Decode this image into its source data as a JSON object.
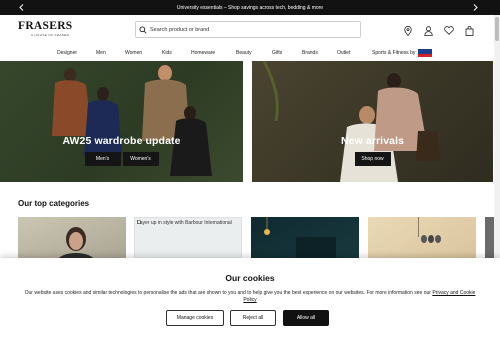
{
  "promo": {
    "text": "University essentials – Shop savings across tech, bedding & more",
    "prev_icon": "chevron-left-icon",
    "next_icon": "chevron-right-icon"
  },
  "header": {
    "logo": {
      "name": "FRASERS",
      "tagline": "A HOUSE OF FRASER"
    },
    "search": {
      "placeholder": "Search product or brand"
    },
    "icons": [
      "location-pin-icon",
      "account-icon",
      "heart-icon",
      "bag-icon"
    ]
  },
  "nav": {
    "items": [
      "Designer",
      "Men",
      "Women",
      "Kids",
      "Homeware",
      "Beauty",
      "Gifts",
      "Brands",
      "Outlet",
      "Sports & Fitness by"
    ]
  },
  "hero": [
    {
      "title": "AW25 wardrobe update",
      "buttons": [
        "Men's",
        "Women's"
      ]
    },
    {
      "title": "New arrivals",
      "buttons": [
        "Shop now"
      ]
    }
  ],
  "categories": {
    "title": "Our top categories",
    "tile_alt": "Layer up in style with Barbour International"
  },
  "cookie": {
    "title": "Our cookies",
    "description": "Our website uses cookies and similar technologies to personalise the ads that are shown to you and to help give you the best experience on our websites. For more information see our ",
    "link": "Privacy and Cookie Policy",
    "buttons": {
      "manage": "Manage cookies",
      "reject": "Reject all",
      "allow": "Allow all"
    }
  },
  "colors": {
    "dark": "#121212",
    "accent_blue": "#1b3d8f",
    "accent_red": "#d6202a"
  }
}
